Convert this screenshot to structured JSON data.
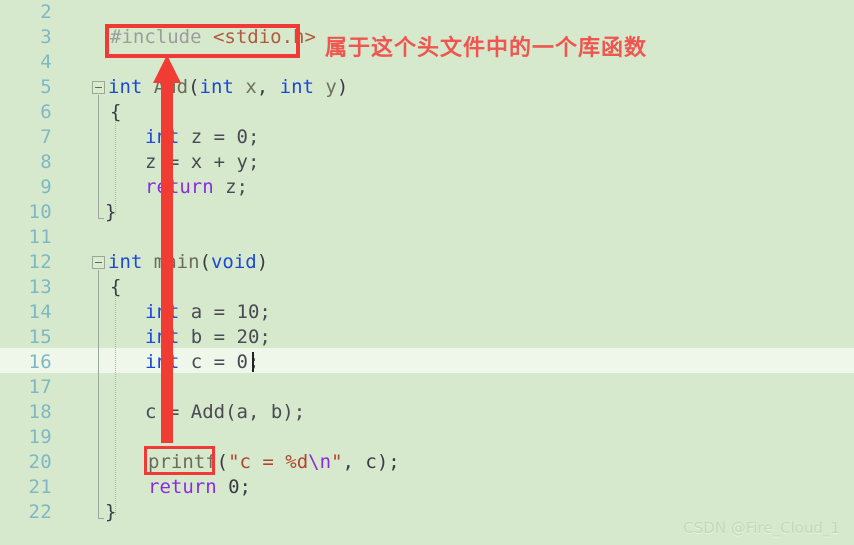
{
  "editor": {
    "background_color": "#d6e9cd",
    "gutter_color": "#7fb8c4",
    "current_line_color": "#eef7ea",
    "first_line_number": 2,
    "last_line_number": 22
  },
  "line_numbers": [
    2,
    3,
    4,
    5,
    6,
    7,
    8,
    9,
    10,
    11,
    12,
    13,
    14,
    15,
    16,
    17,
    18,
    19,
    20,
    21,
    22
  ],
  "code_lines": [
    {
      "num": 2,
      "text": ""
    },
    {
      "num": 3,
      "text": "#include <stdio.h>"
    },
    {
      "num": 4,
      "text": ""
    },
    {
      "num": 5,
      "text": "int Add(int x, int y)"
    },
    {
      "num": 6,
      "text": "{"
    },
    {
      "num": 7,
      "text": "    int z = 0;"
    },
    {
      "num": 8,
      "text": "    z = x + y;"
    },
    {
      "num": 9,
      "text": "    return z;"
    },
    {
      "num": 10,
      "text": "}"
    },
    {
      "num": 11,
      "text": ""
    },
    {
      "num": 12,
      "text": "int main(void)"
    },
    {
      "num": 13,
      "text": "{"
    },
    {
      "num": 14,
      "text": "    int a = 10;"
    },
    {
      "num": 15,
      "text": "    int b = 20;"
    },
    {
      "num": 16,
      "text": "    int c = 0;"
    },
    {
      "num": 17,
      "text": ""
    },
    {
      "num": 18,
      "text": "    c = Add(a, b);"
    },
    {
      "num": 19,
      "text": ""
    },
    {
      "num": 20,
      "text": "    printf(\"c = %d\\n\", c);"
    },
    {
      "num": 21,
      "text": "    return 0;"
    },
    {
      "num": 22,
      "text": "}"
    }
  ],
  "tokens": {
    "l3_include": "#include",
    "l3_header": "<stdio.h>",
    "l5_int": "int",
    "l5_name": " Add",
    "l5_open": "(",
    "l5_kw1": "int",
    "l5_x": " x",
    "l5_comma": ", ",
    "l5_kw2": "int",
    "l5_y": " y",
    "l5_close": ")",
    "l6_brace": "{",
    "l7_kw": "int",
    "l7_rest": " z = 0;",
    "l8_text": "z = x + y;",
    "l9_kw": "return",
    "l9_rest": " z;",
    "l10_brace": "}",
    "l12_int": "int",
    "l12_name": " main",
    "l12_open": "(",
    "l12_void": "void",
    "l12_close": ")",
    "l13_brace": "{",
    "l14_kw": "int",
    "l14_rest": " a = 10;",
    "l15_kw": "int",
    "l15_rest": " b = 20;",
    "l16_kw": "int",
    "l16_rest": " c = 0;",
    "l18_text": "c = Add(a, b);",
    "l20_fn": "printf",
    "l20_open": "(",
    "l20_str": "\"c = %d",
    "l20_esc": "\\n",
    "l20_strend": "\"",
    "l20_rest": ", c);",
    "l21_kw": "return",
    "l21_rest": " 0;",
    "l22_brace": "}"
  },
  "annotations": {
    "chinese_note": "属于这个头文件中的一个库函数",
    "note_color": "#f0554f",
    "box_color": "#ef3a36",
    "arrow_color": "#f03c33",
    "include_box_target": "#include <stdio.h>",
    "printf_box_target": "printf"
  },
  "watermark": {
    "text": "CSDN @Fire_Cloud_1"
  }
}
